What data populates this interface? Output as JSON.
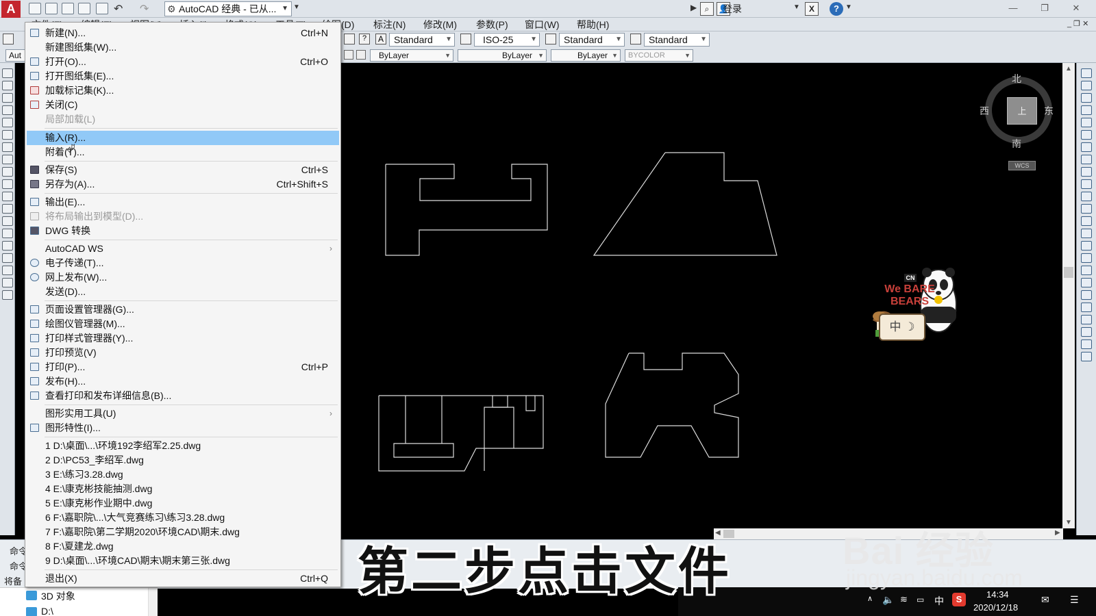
{
  "titlebar": {
    "workspace": "AutoCAD 经典 - 已从...",
    "login": "登录",
    "app_logo": "A"
  },
  "menubar": [
    "文件(F)",
    "编辑(E)",
    "视图(V)",
    "插入(I)",
    "格式(O)",
    "工具(T)",
    "绘图(D)",
    "标注(N)",
    "修改(M)",
    "参数(P)",
    "窗口(W)",
    "帮助(H)"
  ],
  "toolbar": {
    "text_style": "Standard",
    "dim_style": "ISO-25",
    "table_style": "Standard",
    "mleader_style": "Standard",
    "layer": "ByLayer",
    "linetype": "ByLayer",
    "lineweight": "ByLayer",
    "plotstyle": "BYCOLOR",
    "layer_box_label": "Aut"
  },
  "file_menu": {
    "g1": [
      {
        "label": "新建(N)...",
        "shortcut": "Ctrl+N"
      },
      {
        "label": "新建图纸集(W)...",
        "shortcut": ""
      },
      {
        "label": "打开(O)...",
        "shortcut": "Ctrl+O"
      },
      {
        "label": "打开图纸集(E)...",
        "shortcut": ""
      },
      {
        "label": "加载标记集(K)...",
        "shortcut": ""
      },
      {
        "label": "关闭(C)",
        "shortcut": ""
      },
      {
        "label": "局部加载(L)",
        "shortcut": ""
      }
    ],
    "g2": [
      {
        "label": "输入(R)...",
        "shortcut": ""
      },
      {
        "label": "附着(T)...",
        "shortcut": ""
      }
    ],
    "g3": [
      {
        "label": "保存(S)",
        "shortcut": "Ctrl+S"
      },
      {
        "label": "另存为(A)...",
        "shortcut": "Ctrl+Shift+S"
      }
    ],
    "g4": [
      {
        "label": "输出(E)...",
        "shortcut": ""
      },
      {
        "label": "将布局输出到模型(D)...",
        "shortcut": ""
      },
      {
        "label": "DWG 转换",
        "shortcut": ""
      }
    ],
    "g5": [
      {
        "label": "AutoCAD WS",
        "shortcut": ""
      },
      {
        "label": "电子传递(T)...",
        "shortcut": ""
      },
      {
        "label": "网上发布(W)...",
        "shortcut": ""
      },
      {
        "label": "发送(D)...",
        "shortcut": ""
      }
    ],
    "g6": [
      {
        "label": "页面设置管理器(G)...",
        "shortcut": ""
      },
      {
        "label": "绘图仪管理器(M)...",
        "shortcut": ""
      },
      {
        "label": "打印样式管理器(Y)...",
        "shortcut": ""
      },
      {
        "label": "打印预览(V)",
        "shortcut": ""
      },
      {
        "label": "打印(P)...",
        "shortcut": "Ctrl+P"
      },
      {
        "label": "发布(H)...",
        "shortcut": ""
      },
      {
        "label": "查看打印和发布详细信息(B)...",
        "shortcut": ""
      }
    ],
    "g7": [
      {
        "label": "图形实用工具(U)",
        "shortcut": ""
      },
      {
        "label": "图形特性(I)...",
        "shortcut": ""
      }
    ],
    "recent": [
      "1 D:\\桌面\\...\\环境192李绍军2.25.dwg",
      "2 D:\\PC53_李绍军.dwg",
      "3 E:\\练习3.28.dwg",
      "4 E:\\康克彬技能抽测.dwg",
      "5 E:\\康克彬作业期中.dwg",
      "6 F:\\嘉职院\\...\\大气竞赛练习\\练习3.28.dwg",
      "7 F:\\嘉职院\\第二学期2020\\环境CAD\\期末.dwg",
      "8 F:\\夏建龙.dwg",
      "9 D:\\桌面\\...\\环境CAD\\期末\\期末第三张.dwg"
    ],
    "exit": {
      "label": "退出(X)",
      "shortcut": "Ctrl+Q"
    }
  },
  "compass": {
    "north": "北",
    "south": "南",
    "east": "东",
    "west": "西",
    "face": "上",
    "wcs": "WCS"
  },
  "command": {
    "label1": "命令",
    "label2": "命令",
    "label3": "将备"
  },
  "explorer": {
    "item1": "3D 对象",
    "item2": "D:\\"
  },
  "taskbar": {
    "time": "14:34",
    "date": "2020/12/18",
    "ime": "中"
  },
  "overlay": {
    "subtitle": "第二步点击文件",
    "watermark": "Bai 经验",
    "watermark_url": "jingyan.baidu.com"
  },
  "sticker": {
    "brand": "CN",
    "title": "We BARE BEARS",
    "bottom": "中 ☽"
  }
}
